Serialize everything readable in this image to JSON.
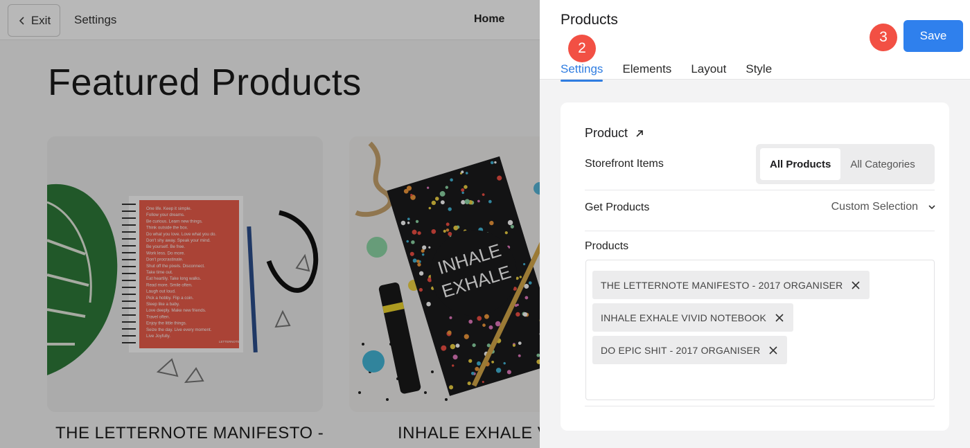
{
  "topbar": {
    "exit_label": "Exit",
    "settings_label": "Settings",
    "home_label": "Home"
  },
  "preview": {
    "title": "Featured Products",
    "cards": [
      {
        "caption": "THE LETTERNOTE MANIFESTO -"
      },
      {
        "caption": "INHALE EXHALE V"
      }
    ]
  },
  "panel": {
    "title": "Products",
    "save_label": "Save",
    "tabs": [
      "Settings",
      "Elements",
      "Layout",
      "Style"
    ],
    "active_tab": "Settings",
    "badges": {
      "step2": "2",
      "step3": "3"
    },
    "section_title": "Product",
    "storefront": {
      "label": "Storefront Items",
      "options": [
        "All Products",
        "All Categories"
      ],
      "selected": "All Products"
    },
    "get_products": {
      "label": "Get Products",
      "value": "Custom Selection"
    },
    "products": {
      "label": "Products",
      "tags": [
        "THE LETTERNOTE MANIFESTO - 2017 ORGANISER",
        "INHALE EXHALE VIVID NOTEBOOK",
        "DO EPIC SHIT - 2017 ORGANISER"
      ]
    }
  },
  "colors": {
    "accent": "#2f80ed",
    "badge": "#f25044"
  },
  "images": {
    "card1_text_lines": [
      "One life. Keep it simple.",
      "Follow your dreams.",
      "Be curious. Learn new things.",
      "Think outside the box.",
      "Do what you love. Love what you do.",
      "Don't shy away. Speak your mind.",
      "Be yourself. Be free.",
      "Work less. Do more.",
      "Don't procrastinate.",
      "Shut off the pixels. Disconnect.",
      "Take time out.",
      "Eat heartily. Take long walks.",
      "Read more. Smile often.",
      "Laugh out loud.",
      "Pick a hobby. Flip a coin.",
      "Sleep like a baby.",
      "Love deeply. Make new friends.",
      "Travel often.",
      "Enjoy the little things.",
      "Seize the day. Live every moment.",
      "Live Joyfully."
    ],
    "card1_brand": "LETTERNOTE",
    "card2_notebook_text": [
      "INHALE",
      "EXHALE"
    ]
  }
}
